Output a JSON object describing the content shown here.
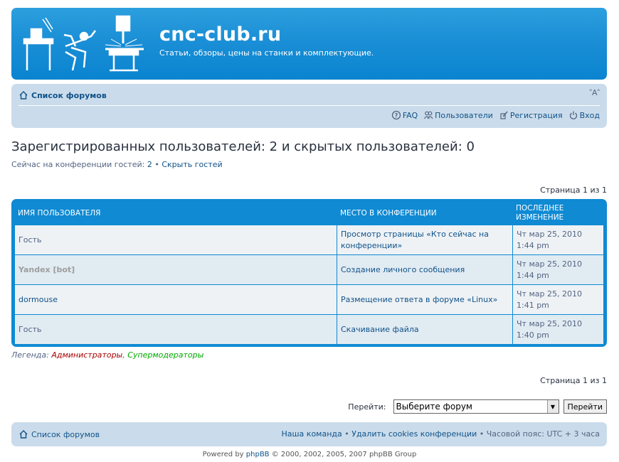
{
  "header": {
    "site_title": "cnc-club.ru",
    "site_description": "Статьи, обзоры, цены на станки и комплектующие."
  },
  "navbar": {
    "home_label": "Список форумов",
    "font_size_control": "˅A˄",
    "links": [
      {
        "icon": "faq-icon",
        "label": "FAQ"
      },
      {
        "icon": "members-icon",
        "label": "Пользователи"
      },
      {
        "icon": "register-icon",
        "label": "Регистрация"
      },
      {
        "icon": "power-icon",
        "label": "Вход"
      }
    ]
  },
  "page": {
    "heading": "Зарегистрированных пользователей: 2 и скрытых пользователей: 0",
    "guests_text": "Сейчас на конференции гостей: ",
    "guests_count": "2",
    "separator": " • ",
    "hide_guests": "Скрыть гостей",
    "pagination": "Страница 1 из 1"
  },
  "table": {
    "headers": [
      "ИМЯ ПОЛЬЗОВАТЕЛЯ",
      "МЕСТО В КОНФЕРЕНЦИИ",
      "ПОСЛЕДНЕЕ ИЗМЕНЕНИЕ"
    ],
    "rows": [
      {
        "user": "Гость",
        "location": "Просмотр страницы «Кто сейчас на конференции»",
        "date": "Чт мар 25, 2010",
        "time": "1:44 pm"
      },
      {
        "user": "Yandex [bot]",
        "location": "Создание личного сообщения",
        "date": "Чт мар 25, 2010",
        "time": "1:44 pm"
      },
      {
        "user": "dormouse",
        "location": "Размещение ответа в форуме «Linux»",
        "date": "Чт мар 25, 2010",
        "time": "1:41 pm"
      },
      {
        "user": "Гость",
        "location": "Скачивание файла",
        "date": "Чт мар 25, 2010",
        "time": "1:40 pm"
      }
    ]
  },
  "legend": {
    "label": "Легенда: ",
    "admins": "Администраторы",
    "comma": ", ",
    "mods": "Супермодераторы"
  },
  "jumpbox": {
    "label": "Перейти:",
    "selected": "Выберите форум",
    "button": "Перейти"
  },
  "footer": {
    "home_label": "Список форумов",
    "team": "Наша команда",
    "sep": " • ",
    "delete_cookies": "Удалить cookies конференции",
    "timezone": "Часовой пояс: UTC + 3 часа",
    "copyright_prefix": "Powered by ",
    "copyright_link": "phpBB",
    "copyright_suffix": " © 2000, 2002, 2005, 2007 phpBB Group"
  },
  "colors": {
    "header_blue": "#1b8fd6",
    "navbar_bg": "#cadceb",
    "link": "#105289",
    "admin": "#aa0000",
    "moderator": "#00aa00"
  }
}
